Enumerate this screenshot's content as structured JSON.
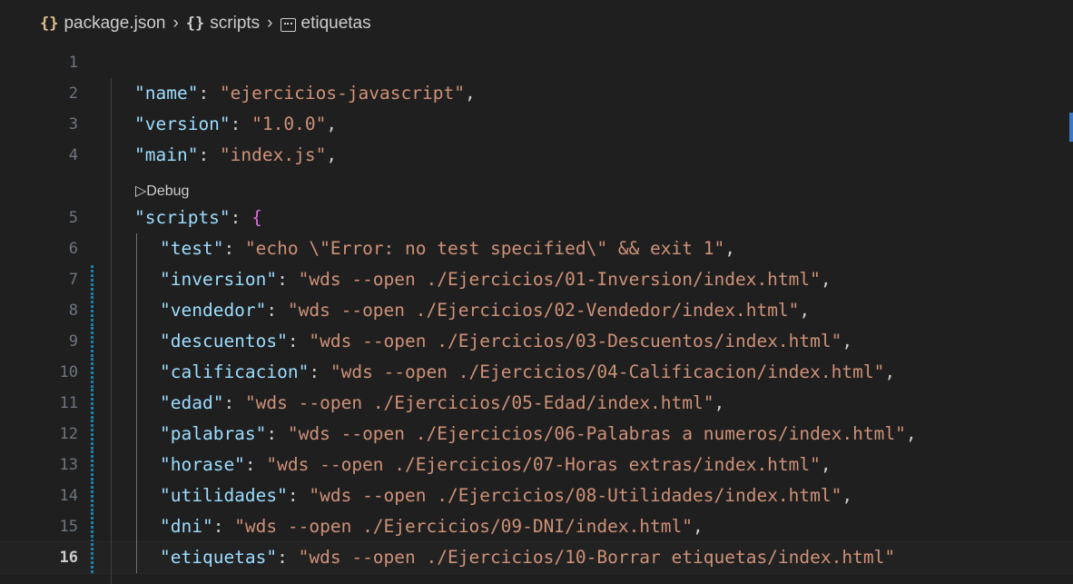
{
  "breadcrumb": {
    "file": "package.json",
    "section": "scripts",
    "key": "etiquetas"
  },
  "codelens": {
    "label": "▷Debug"
  },
  "lines": [
    {
      "n": "1",
      "text": ""
    },
    {
      "n": "2",
      "key": "\"name\"",
      "value": "\"ejercicios-javascript\"",
      "tail": ","
    },
    {
      "n": "3",
      "key": "\"version\"",
      "value": "\"1.0.0\"",
      "tail": ","
    },
    {
      "n": "4",
      "key": "\"main\"",
      "value": "\"index.js\"",
      "tail": ","
    },
    {
      "n": "5",
      "key": "\"scripts\"",
      "brace": "{"
    },
    {
      "n": "6",
      "key": "\"test\"",
      "value": "\"echo \\\"Error: no test specified\\\" && exit 1\"",
      "tail": ","
    },
    {
      "n": "7",
      "key": "\"inversion\"",
      "value": "\"wds --open ./Ejercicios/01-Inversion/index.html\"",
      "tail": ","
    },
    {
      "n": "8",
      "key": "\"vendedor\"",
      "value": "\"wds --open ./Ejercicios/02-Vendedor/index.html\"",
      "tail": ","
    },
    {
      "n": "9",
      "key": "\"descuentos\"",
      "value": "\"wds --open ./Ejercicios/03-Descuentos/index.html\"",
      "tail": ","
    },
    {
      "n": "10",
      "key": "\"calificacion\"",
      "value": "\"wds --open ./Ejercicios/04-Calificacion/index.html\"",
      "tail": ","
    },
    {
      "n": "11",
      "key": "\"edad\"",
      "value": "\"wds --open ./Ejercicios/05-Edad/index.html\"",
      "tail": ","
    },
    {
      "n": "12",
      "key": "\"palabras\"",
      "value": "\"wds --open ./Ejercicios/06-Palabras a numeros/index.html\"",
      "tail": ","
    },
    {
      "n": "13",
      "key": "\"horase\"",
      "value": "\"wds --open ./Ejercicios/07-Horas extras/index.html\"",
      "tail": ","
    },
    {
      "n": "14",
      "key": "\"utilidades\"",
      "value": "\"wds --open ./Ejercicios/08-Utilidades/index.html\"",
      "tail": ","
    },
    {
      "n": "15",
      "key": "\"dni\"",
      "value": "\"wds --open ./Ejercicios/09-DNI/index.html\"",
      "tail": ","
    },
    {
      "n": "16",
      "key": "\"etiquetas\"",
      "value": "\"wds --open ./Ejercicios/10-Borrar etiquetas/index.html\"",
      "tail": ""
    }
  ],
  "colors": {
    "key": "#9cdcfe",
    "string": "#ce9178",
    "brace": "#da70d6",
    "change": "#1b81a8"
  }
}
